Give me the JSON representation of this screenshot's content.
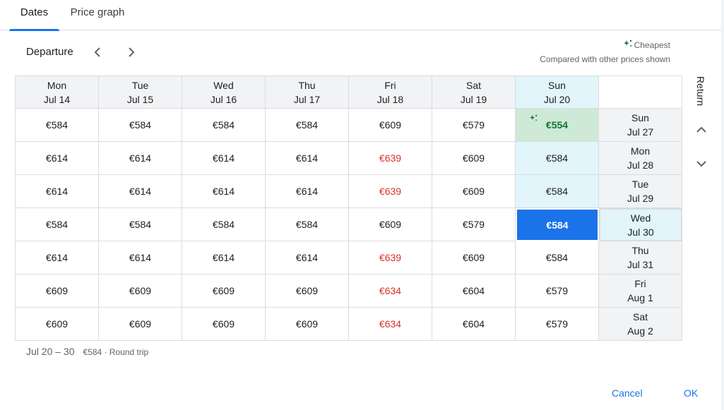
{
  "tabs": [
    {
      "label": "Dates",
      "active": true
    },
    {
      "label": "Price graph",
      "active": false
    }
  ],
  "header": {
    "departure_label": "Departure",
    "prev_icon": "chevron-left-icon",
    "next_icon": "chevron-right-icon"
  },
  "legend": {
    "cheapest_label": "Cheapest",
    "note": "Compared with other prices shown",
    "icon": "sparkle-icon",
    "color": "#137333"
  },
  "departure_days": [
    {
      "day": "Mon",
      "date": "Jul 14"
    },
    {
      "day": "Tue",
      "date": "Jul 15"
    },
    {
      "day": "Wed",
      "date": "Jul 16"
    },
    {
      "day": "Thu",
      "date": "Jul 17"
    },
    {
      "day": "Fri",
      "date": "Jul 18"
    },
    {
      "day": "Sat",
      "date": "Jul 19"
    },
    {
      "day": "Sun",
      "date": "Jul 20"
    }
  ],
  "return_label": "Return",
  "return_days": [
    {
      "day": "Sun",
      "date": "Jul 27",
      "prices": [
        "€584",
        "€584",
        "€584",
        "€584",
        "€609",
        "€579",
        "€554"
      ]
    },
    {
      "day": "Mon",
      "date": "Jul 28",
      "prices": [
        "€614",
        "€614",
        "€614",
        "€614",
        "€639",
        "€609",
        "€584"
      ]
    },
    {
      "day": "Tue",
      "date": "Jul 29",
      "prices": [
        "€614",
        "€614",
        "€614",
        "€614",
        "€639",
        "€609",
        "€584"
      ]
    },
    {
      "day": "Wed",
      "date": "Jul 30",
      "prices": [
        "€584",
        "€584",
        "€584",
        "€584",
        "€609",
        "€579",
        "€584"
      ]
    },
    {
      "day": "Thu",
      "date": "Jul 31",
      "prices": [
        "€614",
        "€614",
        "€614",
        "€614",
        "€639",
        "€609",
        "€584"
      ]
    },
    {
      "day": "Fri",
      "date": "Aug 1",
      "prices": [
        "€609",
        "€609",
        "€609",
        "€609",
        "€634",
        "€604",
        "€579"
      ]
    },
    {
      "day": "Sat",
      "date": "Aug 2",
      "prices": [
        "€609",
        "€609",
        "€609",
        "€609",
        "€634",
        "€604",
        "€579"
      ]
    }
  ],
  "highlights": {
    "selected_departure_index": 6,
    "selected_return_index": 3,
    "cheapest": {
      "row": 0,
      "col": 6
    },
    "high_price_color": "#d93025",
    "selected_color": "#1a73e8",
    "column_highlight_color": "#e1f5fb",
    "cheapest_bg": "#ceead6"
  },
  "summary": {
    "dates": "Jul 20 – 30",
    "price": "€584 · Round trip"
  },
  "actions": {
    "cancel": "Cancel",
    "ok": "OK"
  }
}
